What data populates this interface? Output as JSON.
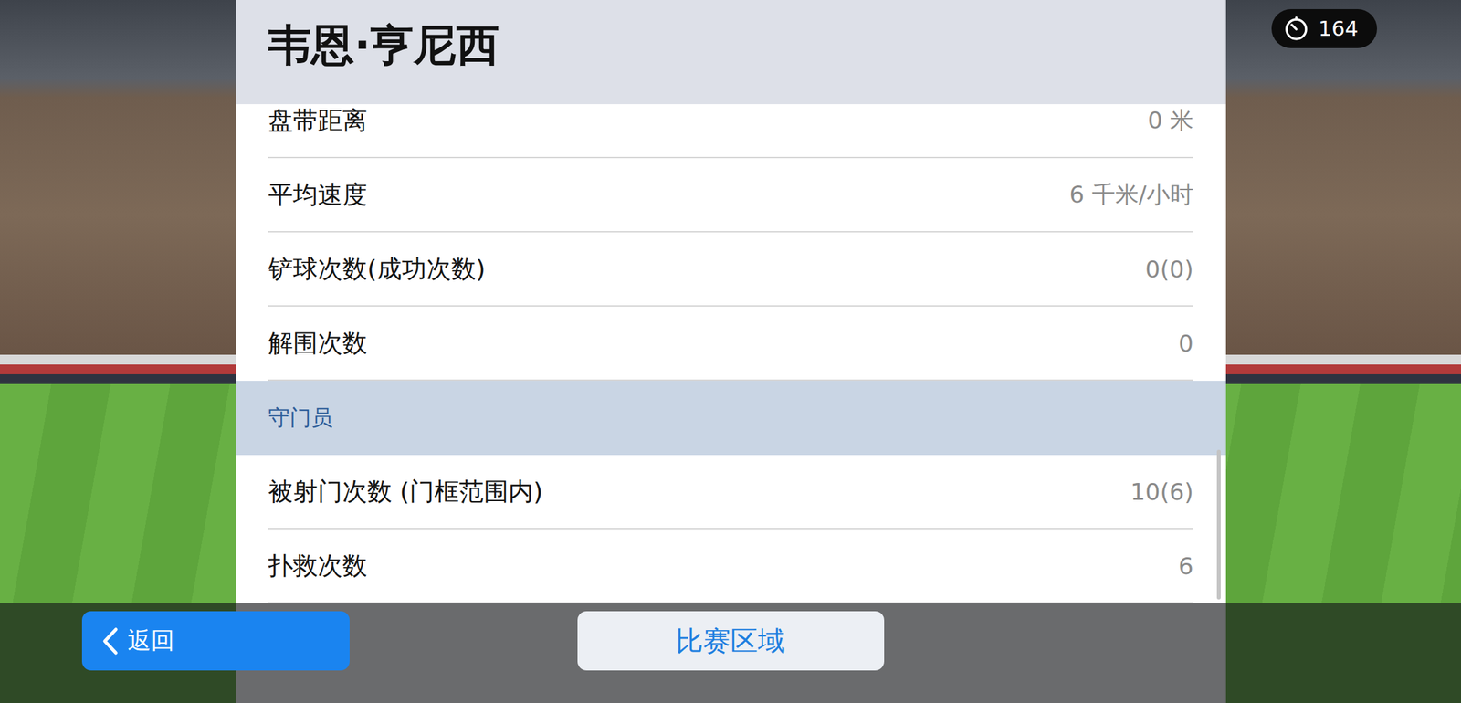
{
  "player_name": "韦恩·亨尼西",
  "rows": [
    {
      "kind": "stat",
      "label": "盘带距离",
      "value": "0 米"
    },
    {
      "kind": "stat",
      "label": "平均速度",
      "value": "6 千米/小时"
    },
    {
      "kind": "stat",
      "label": "铲球次数(成功次数)",
      "value": "0(0)"
    },
    {
      "kind": "stat",
      "label": "解围次数",
      "value": "0"
    },
    {
      "kind": "section",
      "label": "守门员",
      "value": ""
    },
    {
      "kind": "stat",
      "label": "被射门次数 (门框范围内)",
      "value": "10(6)"
    },
    {
      "kind": "stat",
      "label": "扑救次数",
      "value": "6"
    }
  ],
  "scrollbar": {
    "level": 0.3
  },
  "timer": {
    "value": "164"
  },
  "back_button": {
    "label": "返回"
  },
  "center_button": {
    "label": "比赛区域"
  }
}
